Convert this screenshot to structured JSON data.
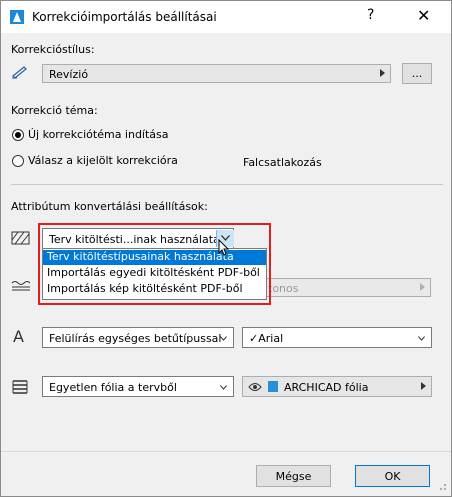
{
  "window": {
    "title": "Korrekcióimportálás beállításai",
    "help": "?",
    "close": "✕"
  },
  "style_section": {
    "label": "Korrekcióstílus:",
    "value": "Revízió",
    "browse_label": "..."
  },
  "topic_section": {
    "label": "Korrekció téma:",
    "radio_new": "Új korrekciótéma indítása",
    "radio_reply": "Válasz a kijelölt korrekcióra",
    "selected_topic": "Falcsatlakozás"
  },
  "attr_section": {
    "label": "Attribútum konvertálási beállítások:",
    "fill_combo_value": "Terv kitöltésti...inak használata",
    "fill_options": [
      "Terv kitöltéstípusainak használata",
      "Importálás egyedi kitöltésként PDF-ből",
      "Importálás kép kitöltésként PDF-ből"
    ],
    "hidden_field_value": "tonos",
    "font_combo_value": "Felülírás egységes betűtípussal",
    "font_value": "Arial",
    "font_check": "✓",
    "layer_combo_value": "Egyetlen fólia a tervből",
    "layer_value": "ARCHICAD fólia"
  },
  "buttons": {
    "cancel": "Mégse",
    "ok": "OK"
  }
}
